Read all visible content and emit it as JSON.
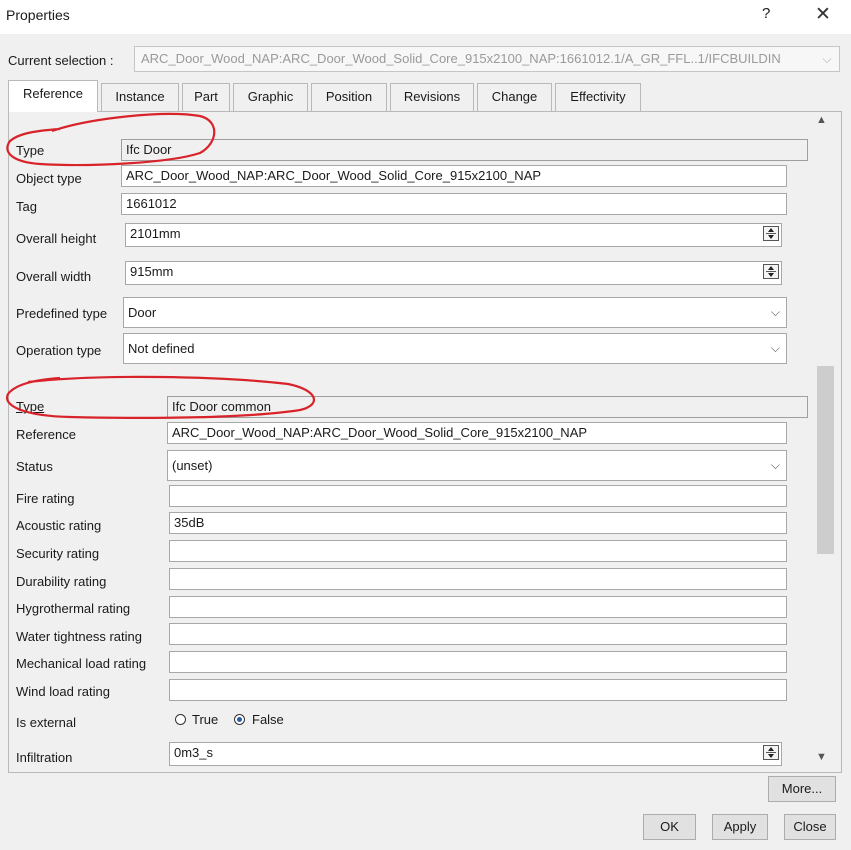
{
  "window": {
    "title": "Properties",
    "help_label": "?",
    "close_label": "✕"
  },
  "selection": {
    "label": "Current selection :",
    "value": "ARC_Door_Wood_NAP:ARC_Door_Wood_Solid_Core_915x2100_NAP:1661012.1/A_GR_FFL..1/IFCBUILDIN",
    "arrow": "⌵"
  },
  "tabs": [
    "Reference",
    "Instance",
    "Part",
    "Graphic",
    "Position",
    "Revisions",
    "Change",
    "Effectivity"
  ],
  "active_tab": "Reference",
  "group1": {
    "type_label": "Type",
    "type_value": "Ifc Door",
    "object_type_label": "Object type",
    "object_type_value": "ARC_Door_Wood_NAP:ARC_Door_Wood_Solid_Core_915x2100_NAP",
    "tag_label": "Tag",
    "tag_value": "1661012",
    "overall_height_label": "Overall height",
    "overall_height_value": "2101mm",
    "overall_width_label": "Overall width",
    "overall_width_value": "915mm",
    "predefined_type_label": "Predefined type",
    "predefined_type_value": "Door",
    "operation_type_label": "Operation type",
    "operation_type_value": "Not defined"
  },
  "group2": {
    "type_label": "Type",
    "type_value": "Ifc Door common",
    "reference_label": "Reference",
    "reference_value": "ARC_Door_Wood_NAP:ARC_Door_Wood_Solid_Core_915x2100_NAP",
    "status_label": "Status",
    "status_value": "(unset)",
    "fire_rating_label": "Fire rating",
    "fire_rating_value": "",
    "acoustic_rating_label": "Acoustic rating",
    "acoustic_rating_value": "35dB",
    "security_rating_label": "Security rating",
    "security_rating_value": "",
    "durability_rating_label": "Durability rating",
    "durability_rating_value": "",
    "hygrothermal_rating_label": "Hygrothermal rating",
    "hygrothermal_rating_value": "",
    "water_tightness_rating_label": "Water tightness rating",
    "water_tightness_rating_value": "",
    "mechanical_load_rating_label": "Mechanical load rating",
    "mechanical_load_rating_value": "",
    "wind_load_rating_label": "Wind load rating",
    "wind_load_rating_value": "",
    "is_external_label": "Is external",
    "true_label": "True",
    "false_label": "False",
    "is_external_value": false,
    "infiltration_label": "Infiltration",
    "infiltration_value": "0m3_s"
  },
  "buttons": {
    "more": "More...",
    "ok": "OK",
    "apply": "Apply",
    "close": "Close"
  },
  "colors": {
    "annotation": "#d8232a",
    "dialog_bg": "#f0f0f0",
    "radio_accent": "#2a5da8"
  },
  "icons": {
    "chevron": "chevron-down-icon",
    "spin": "spin-arrows-icon",
    "scroll_up": "scroll-up-icon",
    "scroll_down": "scroll-down-icon"
  }
}
